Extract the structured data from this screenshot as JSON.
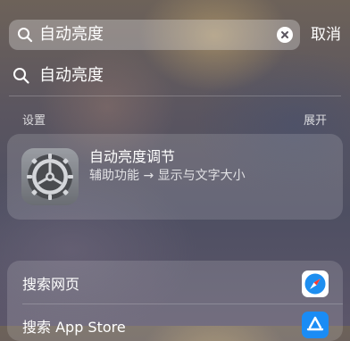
{
  "search": {
    "query": "自动亮度",
    "cancel_label": "取消",
    "icon": "search-icon",
    "clear_icon": "clear-icon"
  },
  "suggestion": {
    "text": "自动亮度",
    "icon": "search-icon"
  },
  "settings_section": {
    "header": "设置",
    "expand_label": "展开",
    "result": {
      "title": "自动亮度调节",
      "subtitle": "辅助功能 → 显示与文字大小",
      "icon": "settings-gear-icon"
    }
  },
  "web_section": {
    "items": [
      {
        "label": "搜索网页",
        "icon": "safari-icon"
      },
      {
        "label": "搜索 App Store",
        "icon": "app-store-icon"
      }
    ]
  },
  "colors": {
    "safari_blue": "#1e8ef0",
    "app_store_blue": "#1a8cf5"
  }
}
